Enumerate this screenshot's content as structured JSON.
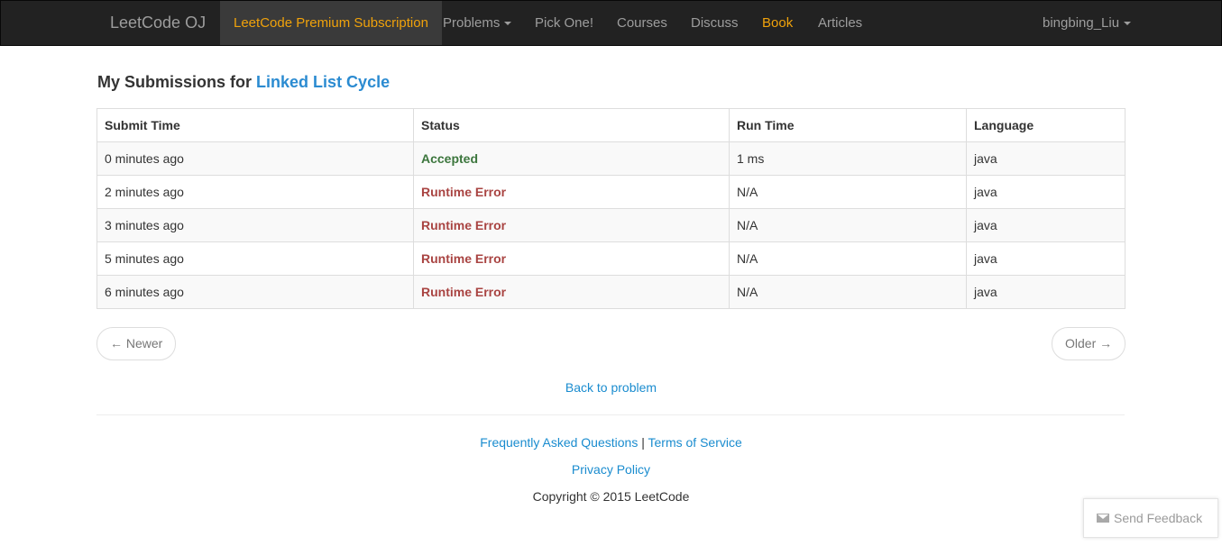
{
  "navbar": {
    "brand": "LeetCode OJ",
    "premium": "LeetCode Premium Subscription",
    "problems": "Problems",
    "pick_one": "Pick One!",
    "courses": "Courses",
    "discuss": "Discuss",
    "book": "Book",
    "articles": "Articles",
    "user": "bingbing_Liu"
  },
  "heading": {
    "prefix": "My Submissions for",
    "problem": "Linked List Cycle"
  },
  "table": {
    "headers": [
      "Submit Time",
      "Status",
      "Run Time",
      "Language"
    ],
    "rows": [
      {
        "submit_time": "0 minutes ago",
        "status": "Accepted",
        "run_time": "1 ms",
        "language": "java"
      },
      {
        "submit_time": "2 minutes ago",
        "status": "Runtime Error",
        "run_time": "N/A",
        "language": "java"
      },
      {
        "submit_time": "3 minutes ago",
        "status": "Runtime Error",
        "run_time": "N/A",
        "language": "java"
      },
      {
        "submit_time": "5 minutes ago",
        "status": "Runtime Error",
        "run_time": "N/A",
        "language": "java"
      },
      {
        "submit_time": "6 minutes ago",
        "status": "Runtime Error",
        "run_time": "N/A",
        "language": "java"
      }
    ]
  },
  "pager": {
    "newer": "← Newer",
    "older": "Older →"
  },
  "back_link": "Back to problem",
  "footer": {
    "faq": "Frequently Asked Questions",
    "separator": "|",
    "terms": "Terms of Service",
    "privacy": "Privacy Policy",
    "copyright": "Copyright © 2015 LeetCode"
  },
  "feedback": {
    "label": "Send Feedback",
    "icon": "envelope-icon"
  },
  "colors": {
    "navbar_bg": "#222222",
    "accent_orange": "#f0a20b",
    "link_blue": "#1a8ccf",
    "accepted_green": "#3c763d",
    "error_red": "#a94442"
  }
}
